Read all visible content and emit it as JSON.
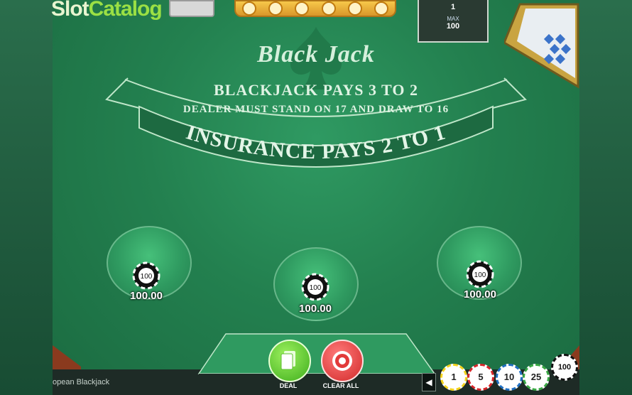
{
  "watermark": {
    "part1": "Slot",
    "part2": "Catalog"
  },
  "limits": {
    "min_value": "1",
    "max_label": "MAX",
    "max_value": "100"
  },
  "table": {
    "title": "Black Jack",
    "blackjack_pays": "BLACKJACK PAYS 3 TO 2",
    "dealer_rule": "DEALER MUST STAND ON 17 AND DRAW TO 16",
    "insurance": "INSURANCE PAYS 2 TO 1"
  },
  "spots": [
    {
      "chip_value": "100",
      "amount": "100.00"
    },
    {
      "chip_value": "100",
      "amount": "100.00"
    },
    {
      "chip_value": "100",
      "amount": "100.00"
    }
  ],
  "controls": {
    "deal_label": "DEAL",
    "clear_label": "CLEAR ALL",
    "prev_arrow": "◀"
  },
  "chip_selector": [
    {
      "value": "1",
      "color": "#f4d31e"
    },
    {
      "value": "5",
      "color": "#d8262a"
    },
    {
      "value": "10",
      "color": "#1f6fc2"
    },
    {
      "value": "25",
      "color": "#3aa845"
    },
    {
      "value": "100",
      "color": "#111111"
    }
  ],
  "game_name": "opean Blackjack",
  "colors": {
    "felt": "#23804f",
    "deal_button": "#5fcf2e",
    "clear_button": "#e23a3a"
  }
}
